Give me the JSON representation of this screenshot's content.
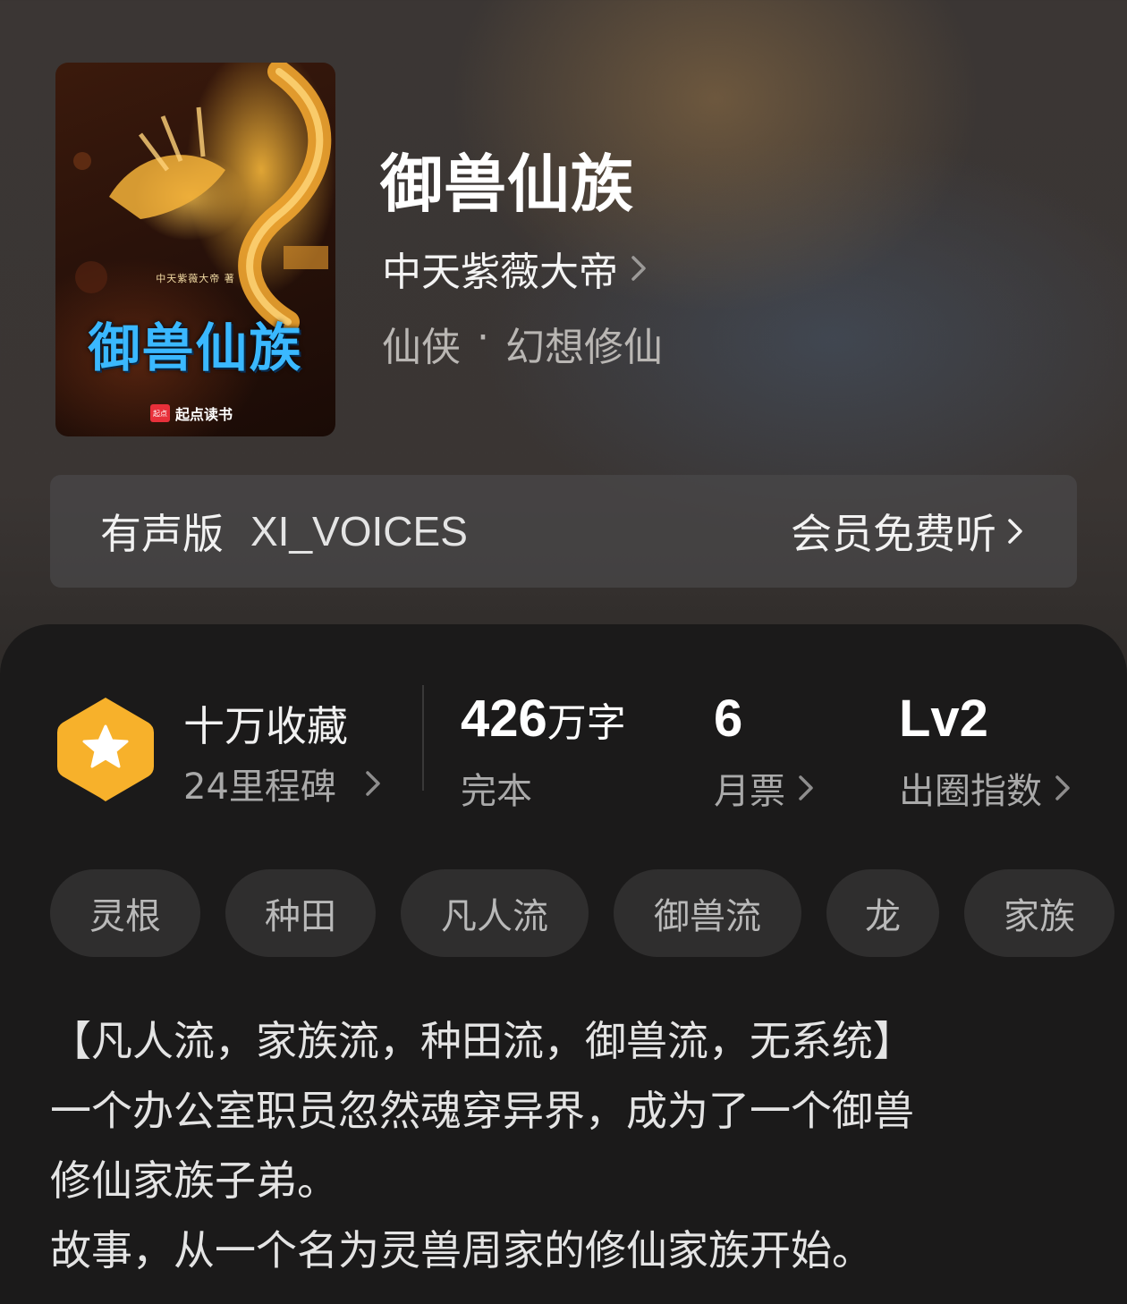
{
  "book": {
    "title": "御兽仙族",
    "author": "中天紫薇大帝",
    "genre_main": "仙侠",
    "genre_separator": "·",
    "genre_sub": "幻想修仙"
  },
  "cover": {
    "author_text": "中天紫薇大帝 著",
    "title_text": "御兽仙族",
    "brand_logo_text": "起点",
    "brand_text": "起点读书",
    "title_color": "#3ab8ff",
    "dragon_color": "#f0a530"
  },
  "audio": {
    "label": "有声版",
    "narrator": "XI_VOICES",
    "cta": "会员免费听"
  },
  "stats": {
    "collect_title": "十万收藏",
    "collect_sub": "24里程碑",
    "words_value": "426",
    "words_unit": "万字",
    "words_label": "完本",
    "tickets_value": "6",
    "tickets_label": "月票",
    "index_value": "Lv2",
    "index_label": "出圈指数",
    "badge_color": "#f7b12b"
  },
  "tags": [
    "灵根",
    "种田",
    "凡人流",
    "御兽流",
    "龙",
    "家族"
  ],
  "synopsis": [
    "【凡人流，家族流，种田流，御兽流，无系统】",
    "一个办公室职员忽然魂穿异界，成为了一个御兽",
    "修仙家族子弟。",
    "故事，从一个名为灵兽周家的修仙家族开始。"
  ]
}
